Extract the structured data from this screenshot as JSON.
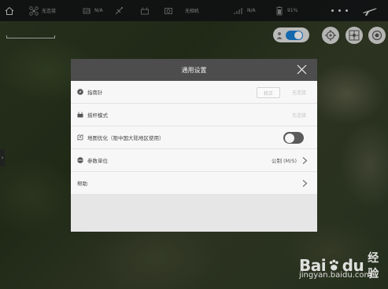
{
  "topbar": {
    "aircraft_status": "无连接",
    "gps_value": "N/A",
    "camera_status": "无相机",
    "signal_value": "N/A",
    "battery_value": "91%"
  },
  "settings": {
    "title": "通用设置",
    "compass": {
      "label": "指南针",
      "calibrate_label": "校正",
      "status": "无连接"
    },
    "stick_mode": {
      "label": "摇杆模式",
      "status": "无连接"
    },
    "map_optimize": {
      "label": "地图优化（限中国大陆地区使用）",
      "enabled": false
    },
    "units": {
      "label": "参数单位",
      "value": "公制 (M/S)"
    },
    "help": {
      "label": "帮助"
    }
  },
  "watermark": {
    "brand": "Bai",
    "brand_suffix": "du",
    "brand_cn": "经验",
    "url": "jingyan.baidu.com"
  },
  "colors": {
    "accent": "#1a7fd4",
    "header": "#4d4d4d"
  }
}
